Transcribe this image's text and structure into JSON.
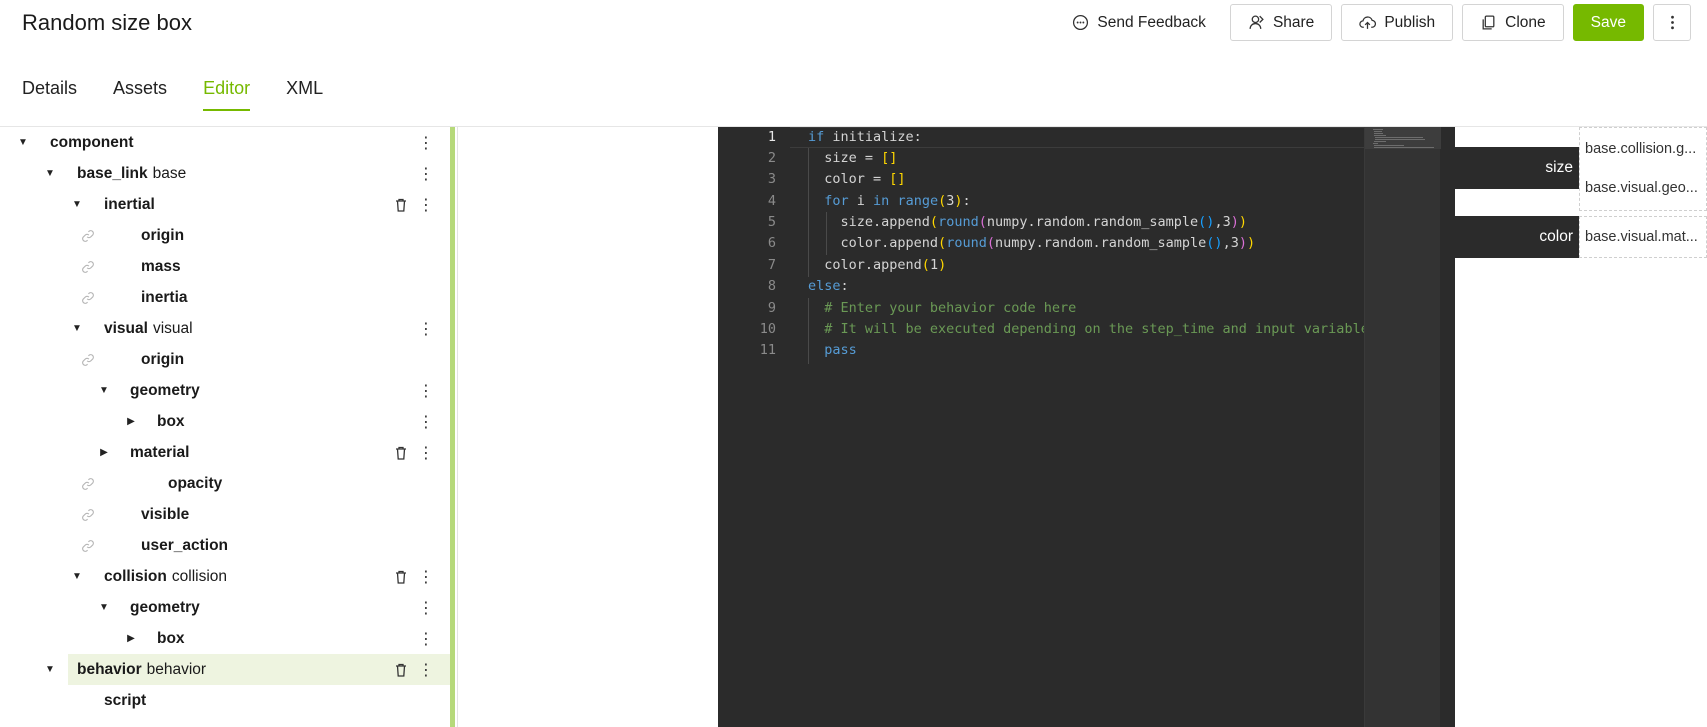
{
  "header": {
    "title": "Random size box",
    "feedback_label": "Send Feedback",
    "share_label": "Share",
    "publish_label": "Publish",
    "clone_label": "Clone",
    "save_label": "Save"
  },
  "tabs": [
    {
      "label": "Details"
    },
    {
      "label": "Assets"
    },
    {
      "label": "Editor"
    },
    {
      "label": "XML"
    }
  ],
  "active_tab": "Editor",
  "tree": {
    "nodes": [
      {
        "label": "component",
        "sub": ""
      },
      {
        "label": "base_link",
        "sub": "base"
      },
      {
        "label": "inertial",
        "sub": ""
      },
      {
        "label": "origin",
        "sub": ""
      },
      {
        "label": "mass",
        "sub": ""
      },
      {
        "label": "inertia",
        "sub": ""
      },
      {
        "label": "visual",
        "sub": "visual"
      },
      {
        "label": "origin",
        "sub": ""
      },
      {
        "label": "geometry",
        "sub": ""
      },
      {
        "label": "box",
        "sub": ""
      },
      {
        "label": "material",
        "sub": ""
      },
      {
        "label": "opacity",
        "sub": ""
      },
      {
        "label": "visible",
        "sub": ""
      },
      {
        "label": "user_action",
        "sub": ""
      },
      {
        "label": "collision",
        "sub": "collision"
      },
      {
        "label": "geometry",
        "sub": ""
      },
      {
        "label": "box",
        "sub": ""
      },
      {
        "label": "behavior",
        "sub": "behavior"
      },
      {
        "label": "script",
        "sub": ""
      }
    ]
  },
  "editor": {
    "line_numbers": [
      "1",
      "2",
      "3",
      "4",
      "5",
      "6",
      "7",
      "8",
      "9",
      "10",
      "11"
    ],
    "current_line": "1"
  },
  "io": {
    "inputs": [
      {
        "name": "size",
        "values": [
          "base.collision.g...",
          "base.visual.geo..."
        ]
      },
      {
        "name": "color",
        "values": [
          "base.visual.mat..."
        ]
      }
    ]
  },
  "colors": {
    "accent": "#76b900",
    "editor_bg": "#2b2b2b",
    "selected_row": "#eef4e0"
  }
}
